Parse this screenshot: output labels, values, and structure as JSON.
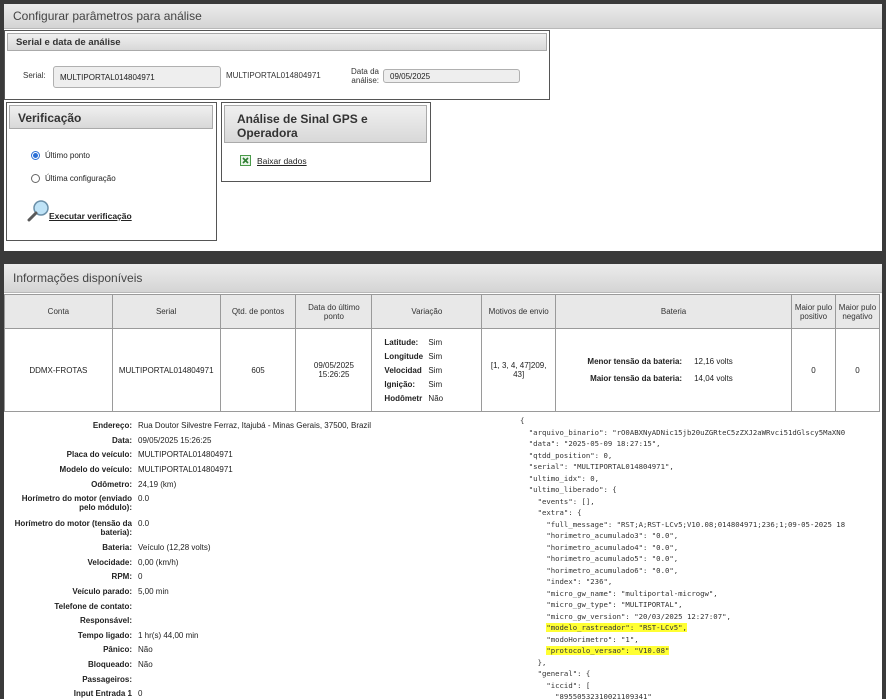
{
  "config_panel": {
    "title": "Configurar parâmetros para análise",
    "serial_section": {
      "title": "Serial e data de análise",
      "serial_label": "Serial:",
      "serial_value": "MULTIPORTAL014804971",
      "serial_echo": "MULTIPORTAL014804971",
      "date_label": "Data da análise:",
      "date_value": "09/05/2025"
    },
    "verification": {
      "title": "Verificação",
      "options": [
        {
          "label": "Último ponto",
          "selected": true
        },
        {
          "label": "Última configuração",
          "selected": false
        }
      ],
      "action_label": "Executar verificação"
    },
    "gps_analysis": {
      "title": "Análise de Sinal GPS e Operadora",
      "download_label": "Baixar dados"
    }
  },
  "info_panel": {
    "title": "Informações disponíveis",
    "columns": [
      "Conta",
      "Serial",
      "Qtd. de pontos",
      "Data do último ponto",
      "Variação",
      "Motivos de envio",
      "Bateria",
      "Maior pulo positivo",
      "Maior pulo negativo"
    ],
    "row": {
      "conta": "DDMX-FROTAS",
      "serial": "MULTIPORTAL014804971",
      "qtd_pontos": "605",
      "data_ultimo_ponto": "09/05/2025 15:26:25",
      "variacao": [
        {
          "label": "Latitude:",
          "value": "Sim"
        },
        {
          "label": "Longitude",
          "value": "Sim"
        },
        {
          "label": "Velocidad",
          "value": "Sim"
        },
        {
          "label": "Ignição:",
          "value": "Sim"
        },
        {
          "label": "Hodômetr",
          "value": "Não"
        }
      ],
      "motivos_envio": "[1, 3, 4, 47]209, 43]",
      "bateria": [
        {
          "label": "Menor tensão da bateria:",
          "value": "12,16 volts"
        },
        {
          "label": "Maior tensão da bateria:",
          "value": "14,04 volts"
        }
      ],
      "maior_pulo_positivo": "0",
      "maior_pulo_negativo": "0"
    },
    "details": [
      {
        "key": "Endereço:",
        "value": "Rua Doutor Silvestre Ferraz, Itajubá - Minas Gerais, 37500, Brazil"
      },
      {
        "key": "Data:",
        "value": "09/05/2025 15:26:25"
      },
      {
        "key": "Placa do veículo:",
        "value": "MULTIPORTAL014804971"
      },
      {
        "key": "Modelo do veículo:",
        "value": "MULTIPORTAL014804971"
      },
      {
        "key": "Odômetro:",
        "value": "24,19 (km)"
      },
      {
        "key": "Horímetro do motor (enviado pelo módulo):",
        "value": "0.0"
      },
      {
        "key": "Horímetro do motor (tensão da bateria):",
        "value": "0.0"
      },
      {
        "key": "Bateria:",
        "value": "Veículo (12,28 volts)"
      },
      {
        "key": "Velocidade:",
        "value": "0,00 (km/h)"
      },
      {
        "key": "RPM:",
        "value": "0"
      },
      {
        "key": "Veículo parado:",
        "value": "5,00 min"
      },
      {
        "key": "Telefone de contato:",
        "value": ""
      },
      {
        "key": "Responsável:",
        "value": ""
      },
      {
        "key": "Tempo ligado:",
        "value": "1 hr(s) 44,00 min"
      },
      {
        "key": "Pânico:",
        "value": "Não"
      },
      {
        "key": "Bloqueado:",
        "value": "Não"
      },
      {
        "key": "Passageiros:",
        "value": ""
      },
      {
        "key": "Input Entrada 1",
        "value": "0"
      }
    ],
    "json_lines": [
      "{",
      "  \"arquivo_binario\": \"rO0ABXNyADNic15jb20uZGRteC5zZXJ2aWRvci51dGlscy5MaXN0",
      "  \"data\": \"2025-05-09 18:27:15\",",
      "  \"qtdd_position\": 0,",
      "  \"serial\": \"MULTIPORTAL014804971\",",
      "  \"ultimo_idx\": 0,",
      "  \"ultimo_liberado\": {",
      "    \"events\": [],",
      "    \"extra\": {",
      "      \"full_message\": \"RST;A;RST-LCv5;V10.08;014804971;236;1;09-05-2025 18",
      "      \"horimetro_acumulado3\": \"0.0\",",
      "      \"horimetro_acumulado4\": \"0.0\",",
      "      \"horimetro_acumulado5\": \"0.0\",",
      "      \"horimetro_acumulado6\": \"0.0\",",
      "      \"index\": \"236\",",
      "      \"micro_gw_name\": \"multiportal-microgw\",",
      "      \"micro_gw_type\": \"MULTIPORTAL\",",
      "      \"micro_gw_version\": \"20/03/2025 12:27:07\",",
      "      \"modelo_rastreador\": \"RST-LCv5\",",
      "      \"modoHorimetro\": \"1\",",
      "      \"protocolo_versao\": \"V10.08\"",
      "    },",
      "    \"general\": {",
      "      \"iccid\": [",
      "        \"89550532310021109341\"",
      "      ],"
    ],
    "highlighted_json_lines": [
      18,
      20
    ]
  }
}
